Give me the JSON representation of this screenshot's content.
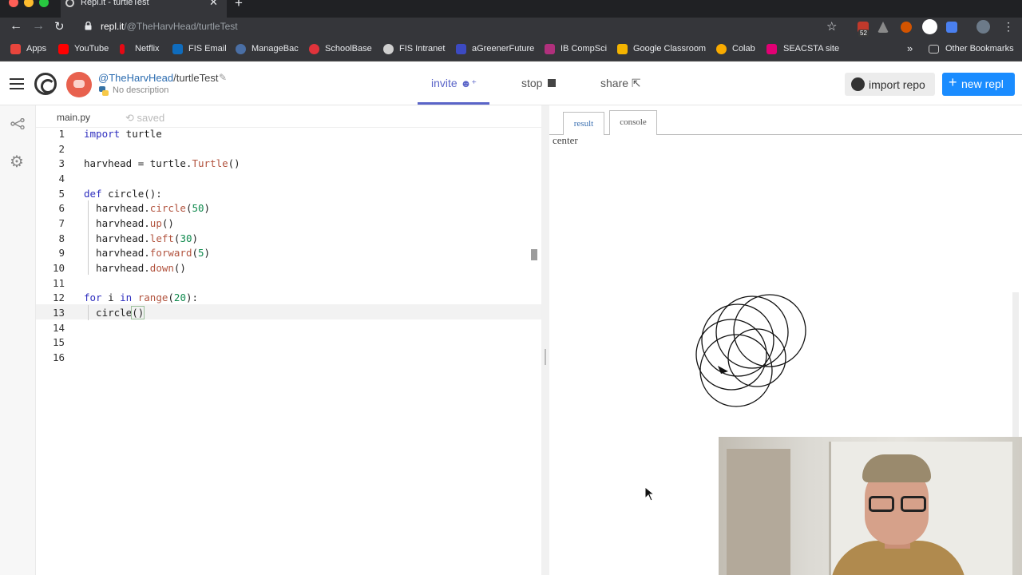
{
  "browser": {
    "tab_title": "Repl.it - turtleTest",
    "url_host": "repl.it",
    "url_path": "/@TheHarvHead/turtleTest",
    "extension_badge": "52",
    "bookmarks": [
      {
        "label": "Apps",
        "icon": "apps-grid-icon",
        "color": "#e8453c"
      },
      {
        "label": "YouTube",
        "icon": "youtube-icon",
        "color": "#ff0000"
      },
      {
        "label": "Netflix",
        "icon": "netflix-icon",
        "color": "#e50914"
      },
      {
        "label": "FIS Email",
        "icon": "outlook-icon",
        "color": "#0f6cbd"
      },
      {
        "label": "ManageBac",
        "icon": "managebac-icon",
        "color": "#4a6fa5"
      },
      {
        "label": "SchoolBase",
        "icon": "schoolbase-icon",
        "color": "#e0333b"
      },
      {
        "label": "FIS Intranet",
        "icon": "globe-icon",
        "color": "#cfcfcf"
      },
      {
        "label": "aGreenerFuture",
        "icon": "greener-icon",
        "color": "#3c4ac2"
      },
      {
        "label": "IB CompSci",
        "icon": "ib-icon",
        "color": "#b0307c"
      },
      {
        "label": "Google Classroom",
        "icon": "classroom-icon",
        "color": "#f4b400"
      },
      {
        "label": "Colab",
        "icon": "colab-icon",
        "color": "#f9ab00"
      },
      {
        "label": "SEACSTA site",
        "icon": "seacsta-icon",
        "color": "#e20074"
      }
    ],
    "overflow": "»",
    "other_bookmarks": "Other Bookmarks"
  },
  "header": {
    "owner": "@TheHarvHead",
    "separator": "/",
    "repl_name": "turtleTest",
    "description": "No description",
    "invite": "invite",
    "stop": "stop",
    "share": "share",
    "import_repo": "import repo",
    "new_repl": "new repl",
    "accent": "#5a64c8",
    "primary": "#1a8cff"
  },
  "editor": {
    "filename": "main.py",
    "status": "saved",
    "current_line": 13,
    "line_numbers": [
      "1",
      "2",
      "3",
      "4",
      "5",
      "6",
      "7",
      "8",
      "9",
      "10",
      "11",
      "12",
      "13",
      "14",
      "15",
      "16"
    ]
  },
  "output": {
    "tab_result": "result",
    "tab_console": "console",
    "console_text": "center"
  }
}
